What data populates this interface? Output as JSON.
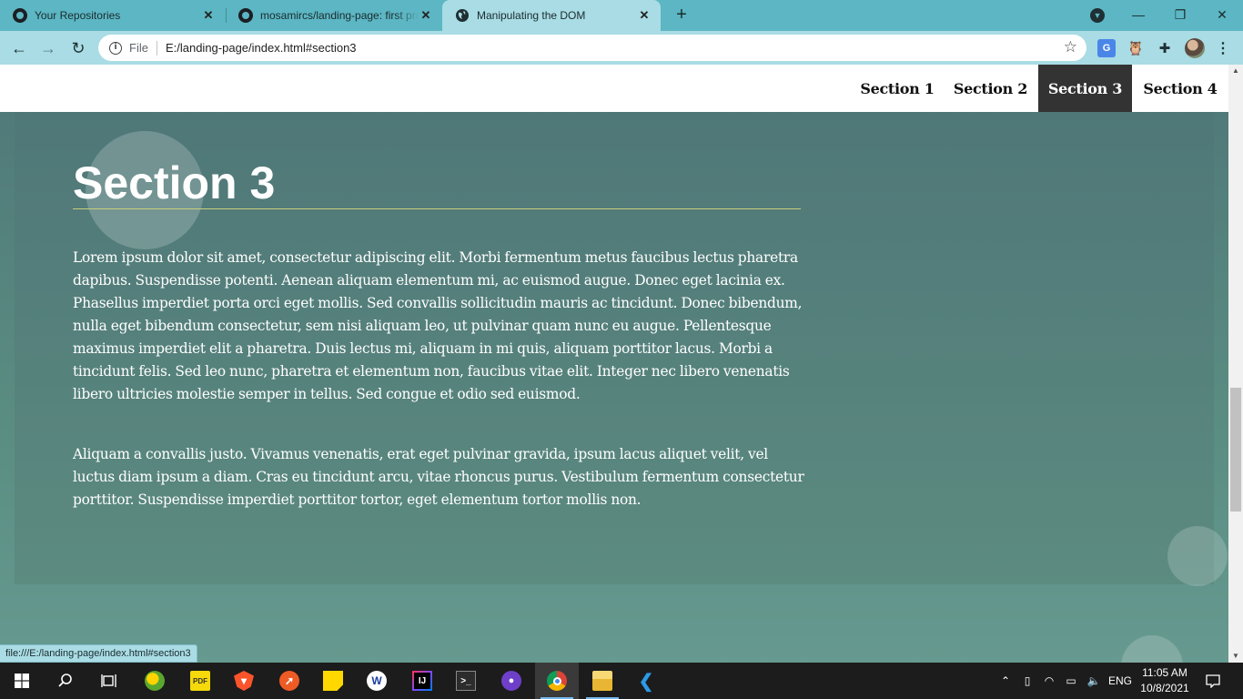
{
  "browser": {
    "tabs": [
      {
        "title": "Your Repositories",
        "icon": "github-icon",
        "active": false
      },
      {
        "title": "mosamircs/landing-page: first project",
        "icon": "github-icon",
        "active": false
      },
      {
        "title": "Manipulating the DOM",
        "icon": "globe-icon",
        "active": true
      }
    ],
    "address": {
      "scheme_label": "File",
      "url": "E:/landing-page/index.html#section3"
    },
    "status_url": "file:///E:/landing-page/index.html#section3",
    "accent": "#5cb6c3"
  },
  "page": {
    "nav": [
      {
        "label": "Section 1",
        "active": false
      },
      {
        "label": "Section 2",
        "active": false
      },
      {
        "label": "Section 3",
        "active": true
      },
      {
        "label": "Section 4",
        "active": false
      }
    ],
    "section": {
      "title": "Section 3",
      "paragraphs": [
        "Lorem ipsum dolor sit amet, consectetur adipiscing elit. Morbi fermentum metus faucibus lectus pharetra dapibus. Suspendisse potenti. Aenean aliquam elementum mi, ac euismod augue. Donec eget lacinia ex. Phasellus imperdiet porta orci eget mollis. Sed convallis sollicitudin mauris ac tincidunt. Donec bibendum, nulla eget bibendum consectetur, sem nisi aliquam leo, ut pulvinar quam nunc eu augue. Pellentesque maximus imperdiet elit a pharetra. Duis lectus mi, aliquam in mi quis, aliquam porttitor lacus. Morbi a tincidunt felis. Sed leo nunc, pharetra et elementum non, faucibus vitae elit. Integer nec libero venenatis libero ultricies molestie semper in tellus. Sed congue et odio sed euismod.",
        "Aliquam a convallis justo. Vivamus venenatis, erat eget pulvinar gravida, ipsum lacus aliquet velit, vel luctus diam ipsum a diam. Cras eu tincidunt arcu, vitae rhoncus purus. Vestibulum fermentum consectetur porttitor. Suspendisse imperdiet porttitor tortor, eget elementum tortor mollis non."
      ]
    }
  },
  "taskbar": {
    "language": "ENG",
    "time": "11:05 AM",
    "date": "10/8/2021"
  }
}
